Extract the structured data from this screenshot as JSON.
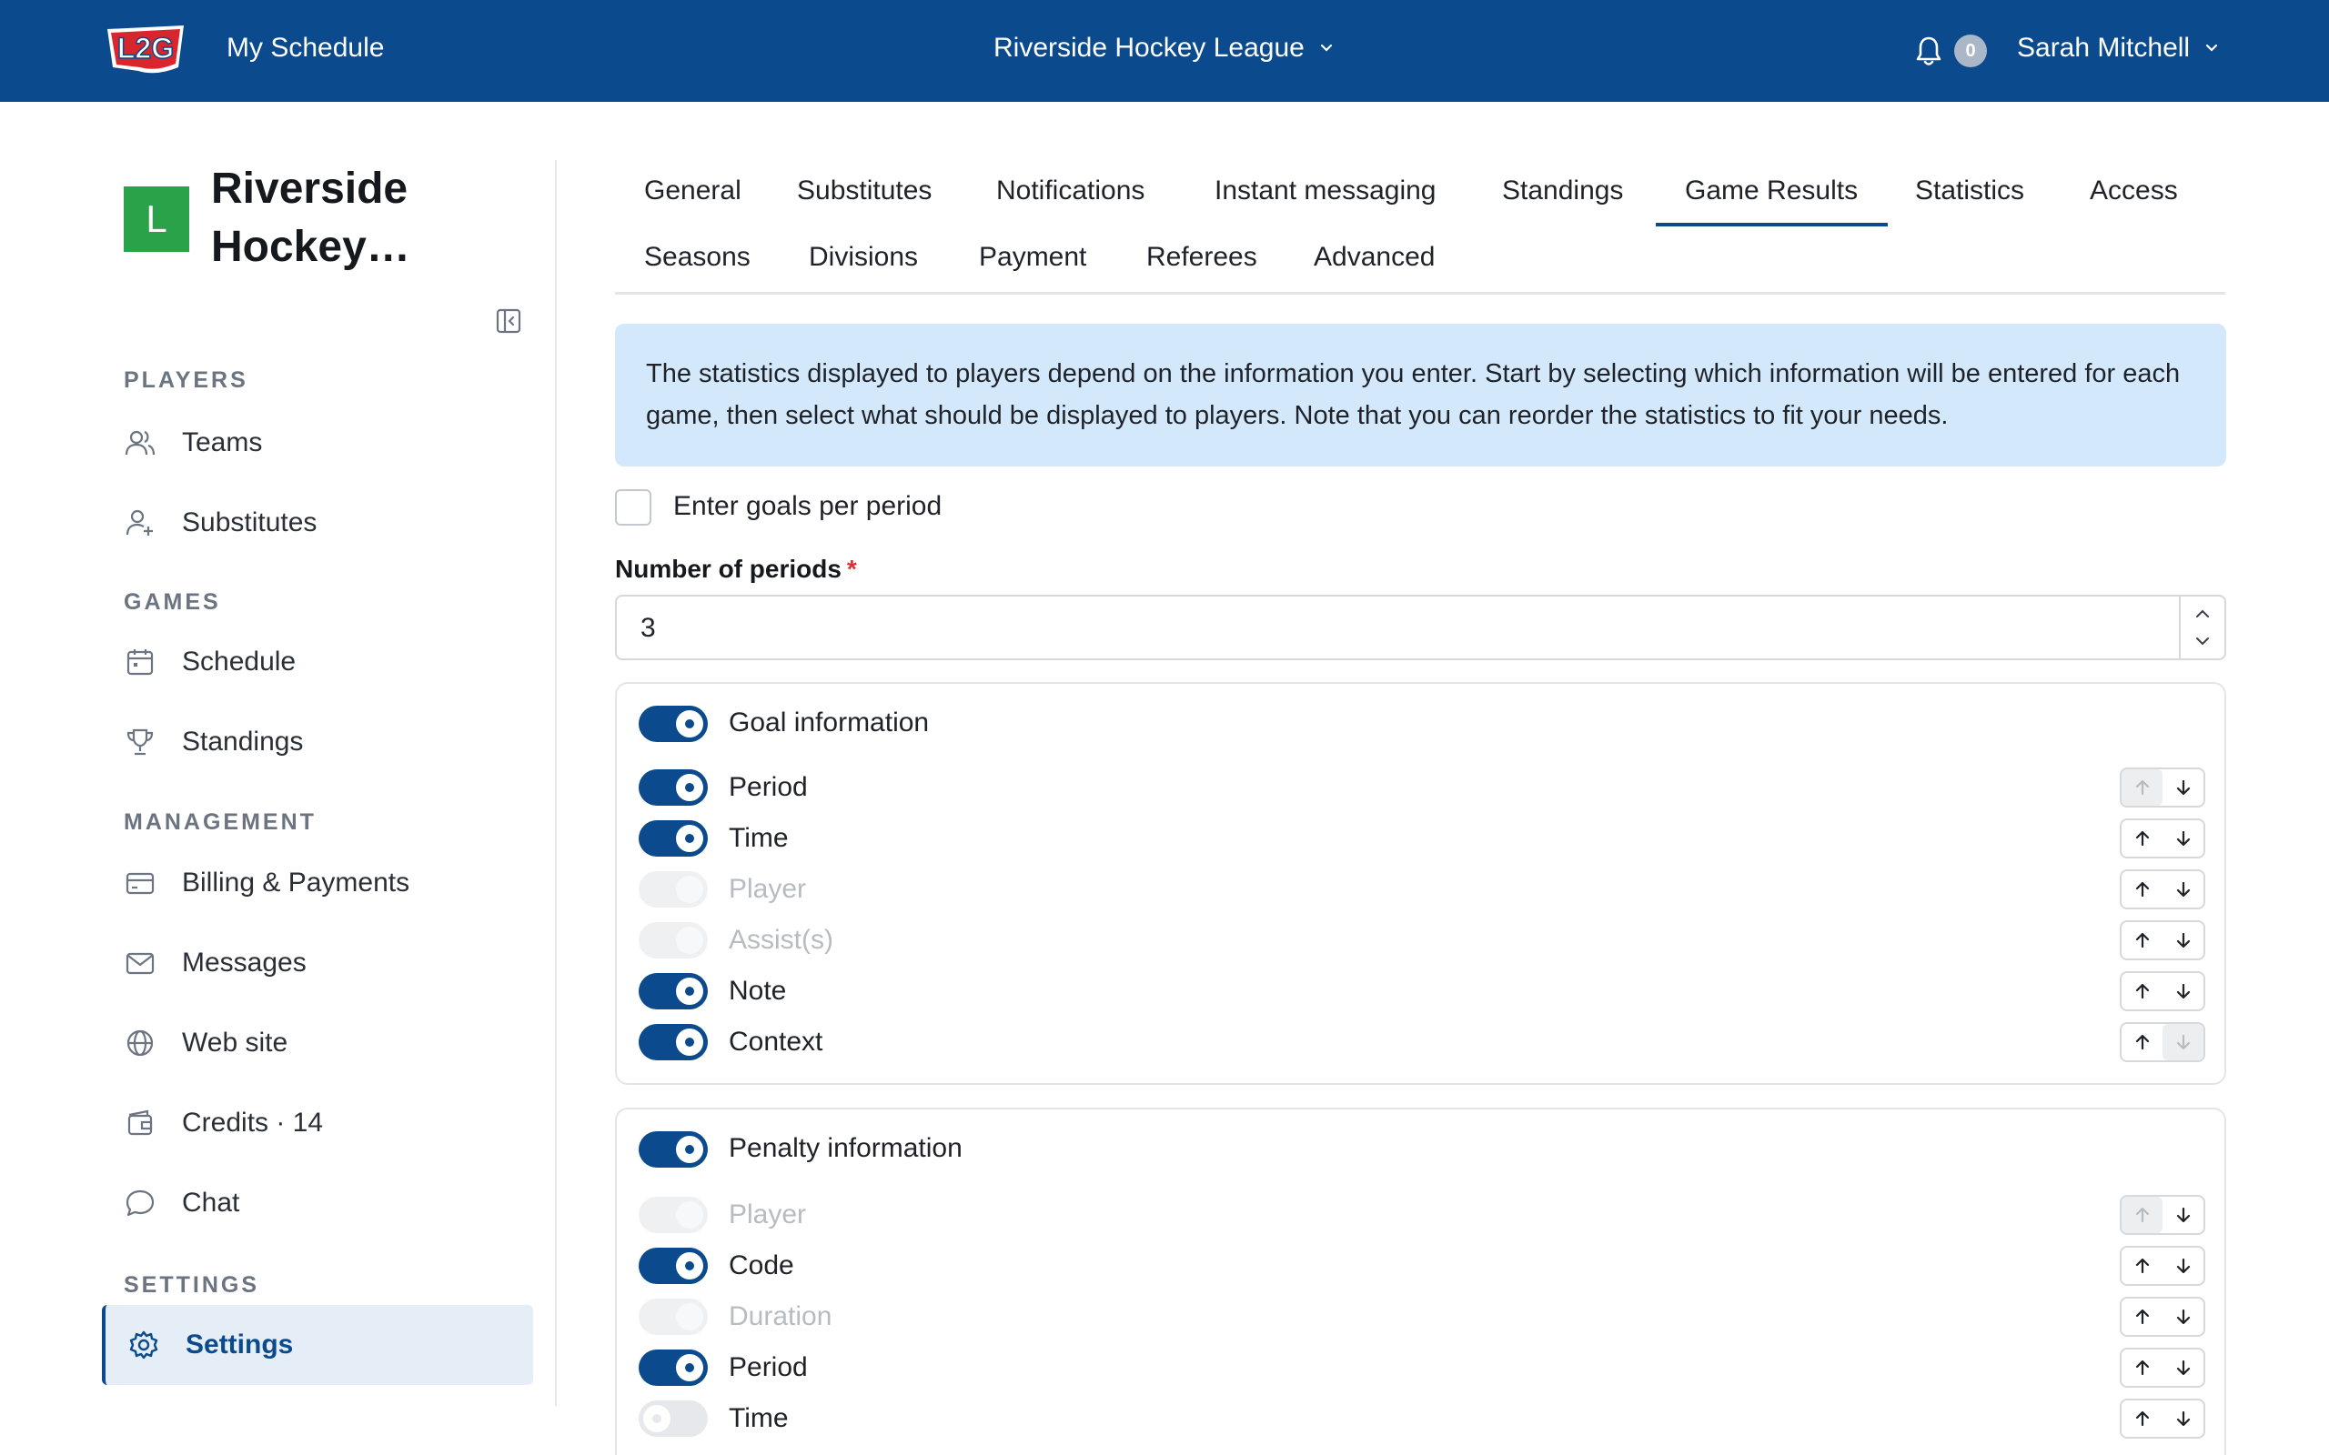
{
  "topbar": {
    "logo": "L2G",
    "my_schedule": "My Schedule",
    "league": "Riverside Hockey League",
    "notif_count": "0",
    "user": "Sarah Mitchell"
  },
  "sidebar": {
    "org_initial": "L",
    "org_name": "Riverside Hockey…",
    "sections": {
      "players": "PLAYERS",
      "games": "GAMES",
      "management": "MANAGEMENT",
      "settings": "SETTINGS"
    },
    "items": {
      "teams": "Teams",
      "substitutes": "Substitutes",
      "schedule": "Schedule",
      "standings": "Standings",
      "billing": "Billing & Payments",
      "messages": "Messages",
      "website": "Web site",
      "credits": "Credits · 14",
      "chat": "Chat",
      "settings": "Settings"
    }
  },
  "tabs": {
    "general": "General",
    "substitutes": "Substitutes",
    "notifications": "Notifications",
    "instant_messaging": "Instant messaging",
    "standings": "Standings",
    "game_results": "Game Results",
    "statistics": "Statistics",
    "access": "Access",
    "seasons": "Seasons",
    "divisions": "Divisions",
    "payment": "Payment",
    "referees": "Referees",
    "advanced": "Advanced",
    "active": "Game Results"
  },
  "info_text": "The statistics displayed to players depend on the information you enter. Start by selecting which information will be entered for each game, then select what should be displayed to players. Note that you can reorder the statistics to fit your needs.",
  "goals_per_period": {
    "label": "Enter goals per period",
    "checked": false
  },
  "periods": {
    "label": "Number of periods",
    "required": "*",
    "value": "3"
  },
  "goal_info": {
    "title": "Goal information",
    "enabled": true,
    "rows": [
      {
        "label": "Period",
        "state": "on"
      },
      {
        "label": "Time",
        "state": "on"
      },
      {
        "label": "Player",
        "state": "disabled"
      },
      {
        "label": "Assist(s)",
        "state": "disabled"
      },
      {
        "label": "Note",
        "state": "on"
      },
      {
        "label": "Context",
        "state": "on"
      }
    ]
  },
  "penalty_info": {
    "title": "Penalty information",
    "enabled": true,
    "rows": [
      {
        "label": "Player",
        "state": "disabled"
      },
      {
        "label": "Code",
        "state": "on"
      },
      {
        "label": "Duration",
        "state": "disabled"
      },
      {
        "label": "Period",
        "state": "on"
      },
      {
        "label": "Time",
        "state": "off"
      }
    ]
  },
  "colors": {
    "brand": "#0b4a8c",
    "info_bg": "#d3e9fb",
    "org_green": "#2aa24a"
  }
}
